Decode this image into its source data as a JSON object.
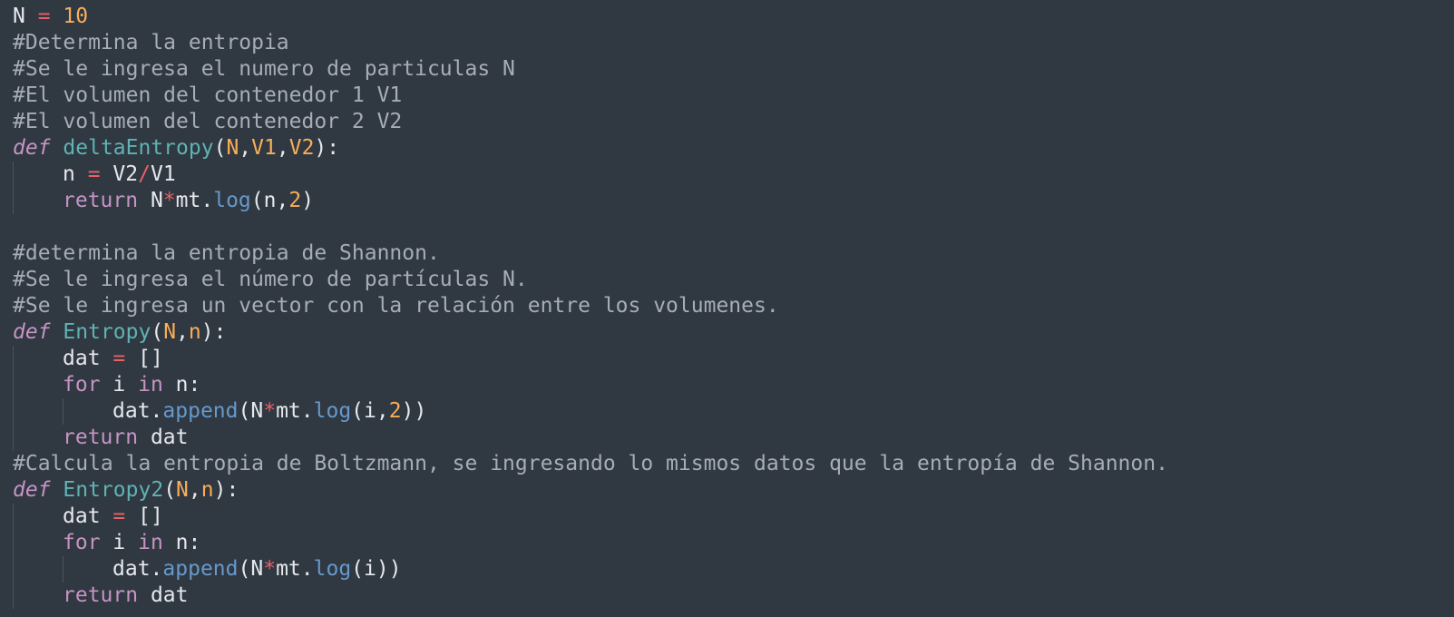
{
  "editor": {
    "lines": [
      {
        "indent": 0,
        "tokens": [
          {
            "t": "N ",
            "c": "t"
          },
          {
            "t": "=",
            "c": "o"
          },
          {
            "t": " ",
            "c": "t"
          },
          {
            "t": "10",
            "c": "nm"
          }
        ]
      },
      {
        "indent": 0,
        "tokens": [
          {
            "t": "#Determina la entropia",
            "c": "c"
          }
        ]
      },
      {
        "indent": 0,
        "tokens": [
          {
            "t": "#Se le ingresa el numero de particulas N",
            "c": "c"
          }
        ]
      },
      {
        "indent": 0,
        "tokens": [
          {
            "t": "#El volumen del contenedor 1 V1",
            "c": "c"
          }
        ]
      },
      {
        "indent": 0,
        "tokens": [
          {
            "t": "#El volumen del contenedor 2 V2",
            "c": "c"
          }
        ]
      },
      {
        "indent": 0,
        "tokens": [
          {
            "t": "def",
            "c": "kd"
          },
          {
            "t": " ",
            "c": "t"
          },
          {
            "t": "deltaEntropy",
            "c": "fn"
          },
          {
            "t": "(",
            "c": "t"
          },
          {
            "t": "N",
            "c": "p"
          },
          {
            "t": ",",
            "c": "t"
          },
          {
            "t": "V1",
            "c": "p"
          },
          {
            "t": ",",
            "c": "t"
          },
          {
            "t": "V2",
            "c": "p"
          },
          {
            "t": "):",
            "c": "t"
          }
        ]
      },
      {
        "indent": 1,
        "tokens": [
          {
            "t": "n ",
            "c": "t"
          },
          {
            "t": "=",
            "c": "o"
          },
          {
            "t": " V2",
            "c": "t"
          },
          {
            "t": "/",
            "c": "o"
          },
          {
            "t": "V1",
            "c": "t"
          }
        ]
      },
      {
        "indent": 1,
        "tokens": [
          {
            "t": "return",
            "c": "k"
          },
          {
            "t": " N",
            "c": "t"
          },
          {
            "t": "*",
            "c": "o"
          },
          {
            "t": "mt",
            "c": "t"
          },
          {
            "t": ".",
            "c": "t"
          },
          {
            "t": "log",
            "c": "m"
          },
          {
            "t": "(n",
            "c": "t"
          },
          {
            "t": ",",
            "c": "t"
          },
          {
            "t": "2",
            "c": "nm"
          },
          {
            "t": ")",
            "c": "t"
          }
        ]
      },
      {
        "indent": 0,
        "tokens": []
      },
      {
        "indent": 0,
        "tokens": [
          {
            "t": "#determina la entropia de Shannon.",
            "c": "c"
          }
        ]
      },
      {
        "indent": 0,
        "tokens": [
          {
            "t": "#Se le ingresa el número de partículas N.",
            "c": "c"
          }
        ]
      },
      {
        "indent": 0,
        "tokens": [
          {
            "t": "#Se le ingresa un vector con la relación entre los volumenes.",
            "c": "c"
          }
        ]
      },
      {
        "indent": 0,
        "tokens": [
          {
            "t": "def",
            "c": "kd"
          },
          {
            "t": " ",
            "c": "t"
          },
          {
            "t": "Entropy",
            "c": "fn"
          },
          {
            "t": "(",
            "c": "t"
          },
          {
            "t": "N",
            "c": "p"
          },
          {
            "t": ",",
            "c": "t"
          },
          {
            "t": "n",
            "c": "p"
          },
          {
            "t": "):",
            "c": "t"
          }
        ]
      },
      {
        "indent": 1,
        "tokens": [
          {
            "t": "dat ",
            "c": "t"
          },
          {
            "t": "=",
            "c": "o"
          },
          {
            "t": " []",
            "c": "t"
          }
        ]
      },
      {
        "indent": 1,
        "tokens": [
          {
            "t": "for",
            "c": "k"
          },
          {
            "t": " i ",
            "c": "t"
          },
          {
            "t": "in",
            "c": "k"
          },
          {
            "t": " n:",
            "c": "t"
          }
        ]
      },
      {
        "indent": 2,
        "tokens": [
          {
            "t": "dat",
            "c": "t"
          },
          {
            "t": ".",
            "c": "t"
          },
          {
            "t": "append",
            "c": "m"
          },
          {
            "t": "(N",
            "c": "t"
          },
          {
            "t": "*",
            "c": "o"
          },
          {
            "t": "mt",
            "c": "t"
          },
          {
            "t": ".",
            "c": "t"
          },
          {
            "t": "log",
            "c": "m"
          },
          {
            "t": "(i",
            "c": "t"
          },
          {
            "t": ",",
            "c": "t"
          },
          {
            "t": "2",
            "c": "nm"
          },
          {
            "t": "))",
            "c": "t"
          }
        ]
      },
      {
        "indent": 1,
        "tokens": [
          {
            "t": "return",
            "c": "k"
          },
          {
            "t": " dat",
            "c": "t"
          }
        ]
      },
      {
        "indent": 0,
        "tokens": [
          {
            "t": "#Calcula la entropia de Boltzmann, se ingresando lo mismos datos que la entropía de Shannon.",
            "c": "c"
          }
        ]
      },
      {
        "indent": 0,
        "tokens": [
          {
            "t": "def",
            "c": "kd"
          },
          {
            "t": " ",
            "c": "t"
          },
          {
            "t": "Entropy2",
            "c": "fn"
          },
          {
            "t": "(",
            "c": "t"
          },
          {
            "t": "N",
            "c": "p"
          },
          {
            "t": ",",
            "c": "t"
          },
          {
            "t": "n",
            "c": "p"
          },
          {
            "t": "):",
            "c": "t"
          }
        ]
      },
      {
        "indent": 1,
        "tokens": [
          {
            "t": "dat ",
            "c": "t"
          },
          {
            "t": "=",
            "c": "o"
          },
          {
            "t": " []",
            "c": "t"
          }
        ]
      },
      {
        "indent": 1,
        "tokens": [
          {
            "t": "for",
            "c": "k"
          },
          {
            "t": " i ",
            "c": "t"
          },
          {
            "t": "in",
            "c": "k"
          },
          {
            "t": " n:",
            "c": "t"
          }
        ]
      },
      {
        "indent": 2,
        "tokens": [
          {
            "t": "dat",
            "c": "t"
          },
          {
            "t": ".",
            "c": "t"
          },
          {
            "t": "append",
            "c": "m"
          },
          {
            "t": "(N",
            "c": "t"
          },
          {
            "t": "*",
            "c": "o"
          },
          {
            "t": "mt",
            "c": "t"
          },
          {
            "t": ".",
            "c": "t"
          },
          {
            "t": "log",
            "c": "m"
          },
          {
            "t": "(i))",
            "c": "t"
          }
        ]
      },
      {
        "indent": 1,
        "tokens": [
          {
            "t": "return",
            "c": "k"
          },
          {
            "t": " dat",
            "c": "t"
          }
        ]
      }
    ]
  },
  "theme": {
    "background": "#303842",
    "comment": "#a7adb5",
    "keyword": "#c594c5",
    "function_name": "#5fb3b3",
    "parameter": "#f9ae58",
    "number": "#f9ae58",
    "operator": "#ec5f66",
    "method": "#6699cc",
    "text": "#e6e8ec"
  }
}
